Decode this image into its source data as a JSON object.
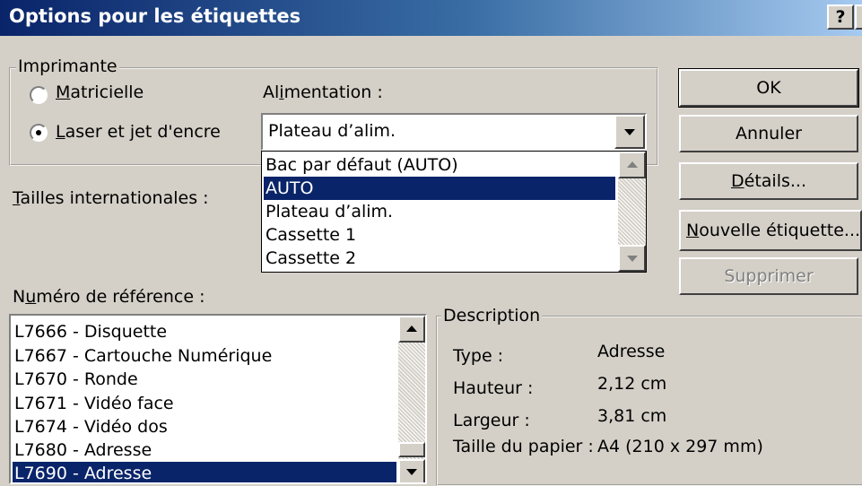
{
  "window": {
    "title": "Options pour les étiquettes",
    "help_button": "?"
  },
  "printer_group": {
    "label": "Imprimante",
    "radio_matrix": {
      "prefix": "",
      "accel": "M",
      "rest": "atricielle",
      "selected": false
    },
    "radio_laser": {
      "prefix": "",
      "accel": "L",
      "rest": "aser et jet d'encre",
      "selected": true
    },
    "feed_label": {
      "prefix": "Al",
      "accel": "i",
      "rest": "mentation :"
    },
    "feed_value": "Plateau d’alim.",
    "feed_options": [
      "Bac par défaut (AUTO)",
      "AUTO",
      "Plateau d’alim.",
      "Cassette 1",
      "Cassette 2"
    ],
    "feed_highlighted_index": 1
  },
  "sizes_label": {
    "prefix": "",
    "accel": "T",
    "rest": "ailles internationales :"
  },
  "buttons": {
    "ok": "OK",
    "cancel": "Annuler",
    "details": {
      "prefix": "",
      "accel": "D",
      "rest": "étails..."
    },
    "new_label": {
      "prefix": "",
      "accel": "N",
      "rest": "ouvelle étiquette..."
    },
    "delete": "Supprimer"
  },
  "reference": {
    "label": {
      "prefix": "N",
      "accel": "u",
      "rest": "méro de référence :"
    },
    "items": [
      "L7666 - Disquette",
      "L7667 - Cartouche Numérique",
      "L7670 - Ronde",
      "L7671 - Vidéo face",
      "L7674 - Vidéo dos",
      "L7680 - Adresse",
      "L7690 - Adresse"
    ],
    "selected_index": 6
  },
  "description": {
    "label": "Description",
    "type_label": "Type :",
    "type_value": "Adresse",
    "height_label": "Hauteur :",
    "height_value": "2,12 cm",
    "width_label": "Largeur :",
    "width_value": "3,81 cm",
    "paper_label": "Taille du papier :",
    "paper_value": "A4 (210 x 297 mm)"
  }
}
